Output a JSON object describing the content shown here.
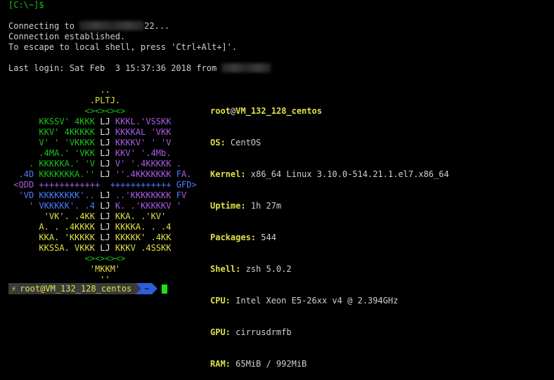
{
  "top_prompt": "[C:\\~]$",
  "connect": {
    "prefix": "Connecting to",
    "suffix": "22...",
    "established": "Connection established.",
    "escape": "To escape to local shell, press 'Ctrl+Alt+]'."
  },
  "last_login": {
    "text": "Last login: Sat Feb  3 15:37:36 2018 from"
  },
  "art": [
    [
      "",
      "                  ..",
      ""
    ],
    [
      "",
      "                .PLTJ.",
      ""
    ],
    [
      "",
      "               <><><><>",
      ""
    ],
    [
      "",
      "      KKSSV' 4KKK LJ ",
      "KKKL.'VSSKK"
    ],
    [
      "",
      "      KKV' 4KKKKK LJ ",
      "KKKKAL 'VKK"
    ],
    [
      "",
      "      V' ' 'VKKKK LJ ",
      "KKKKV' ' 'V"
    ],
    [
      "",
      "      .4MA.' 'VKK LJ ",
      "KKV' '.4Mb."
    ],
    [
      "",
      "    . KKKKKA.' 'V LJ ",
      "V' '.4KKKKK ."
    ],
    [
      "",
      "  .4D KKKKKKKA.'' LJ ",
      "''.4KKKKKKK FA."
    ],
    [
      "",
      " <QDD ++++++++++++  ",
      "++++++++++++ GFD>"
    ],
    [
      "",
      "  'VD KKKKKKKK'.. LJ ",
      "..'KKKKKKKK FV"
    ],
    [
      "",
      "    ' VKKKKK'. .4 LJ ",
      "K. .'KKKKKV '"
    ],
    [
      "",
      "       'VK'. .4KK LJ ",
      "KKA. .'KV'"
    ],
    [
      "",
      "      A. . .4KKKK LJ ",
      "KKKKA. . .4"
    ],
    [
      "",
      "      KKA. 'KKKKK LJ ",
      "KKKKK' .4KK"
    ],
    [
      "",
      "      KKSSA. VKKK LJ ",
      "KKKV .4SSKK"
    ],
    [
      "",
      "               <><><><>",
      ""
    ],
    [
      "",
      "                'MKKM'",
      ""
    ],
    [
      "",
      "                  ''",
      ""
    ]
  ],
  "info": {
    "user": "root",
    "at": "@",
    "host": "VM_132_128_centos",
    "rows": [
      {
        "key": "OS:",
        "value": " CentOS"
      },
      {
        "key": "Kernel:",
        "value": " x86_64 Linux 3.10.0-514.21.1.el7.x86_64"
      },
      {
        "key": "Uptime:",
        "value": " 1h 27m"
      },
      {
        "key": "Packages:",
        "value": " 544"
      },
      {
        "key": "Shell:",
        "value": " zsh 5.0.2"
      },
      {
        "key": "CPU:",
        "value": " Intel Xeon E5-26xx v4 @ 2.394GHz"
      },
      {
        "key": "GPU:",
        "value": " cirrusdrmfb"
      },
      {
        "key": "RAM:",
        "value": " 65MiB / 992MiB"
      }
    ]
  },
  "prompt": {
    "bolt": "⚡",
    "user_host": "root@VM_132_128_centos",
    "dir": "~"
  }
}
